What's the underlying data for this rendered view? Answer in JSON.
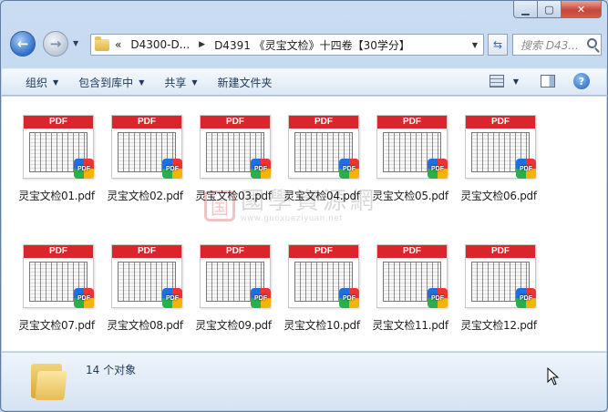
{
  "address": {
    "crumbs": [
      "«",
      "D4300-D...",
      "D4391 《灵宝文检》十四卷【30学分】"
    ],
    "search_placeholder": "搜索 D43..."
  },
  "toolbar": {
    "organize": "组织",
    "include_library": "包含到库中",
    "share": "共享",
    "new_folder": "新建文件夹"
  },
  "files": [
    {
      "name": "灵宝文检01.pdf"
    },
    {
      "name": "灵宝文检02.pdf"
    },
    {
      "name": "灵宝文检03.pdf"
    },
    {
      "name": "灵宝文检04.pdf"
    },
    {
      "name": "灵宝文检05.pdf"
    },
    {
      "name": "灵宝文检06.pdf"
    },
    {
      "name": "灵宝文检07.pdf"
    },
    {
      "name": "灵宝文检08.pdf"
    },
    {
      "name": "灵宝文检09.pdf"
    },
    {
      "name": "灵宝文检10.pdf"
    },
    {
      "name": "灵宝文检11.pdf"
    },
    {
      "name": "灵宝文检12.pdf"
    }
  ],
  "thumb_label": "PDF",
  "badge_label": "PDF",
  "watermark": {
    "seal": "国",
    "cn": "國學資源網",
    "en": "www.guoxueziyuan.net"
  },
  "status": {
    "count_text": "14 个对象"
  }
}
